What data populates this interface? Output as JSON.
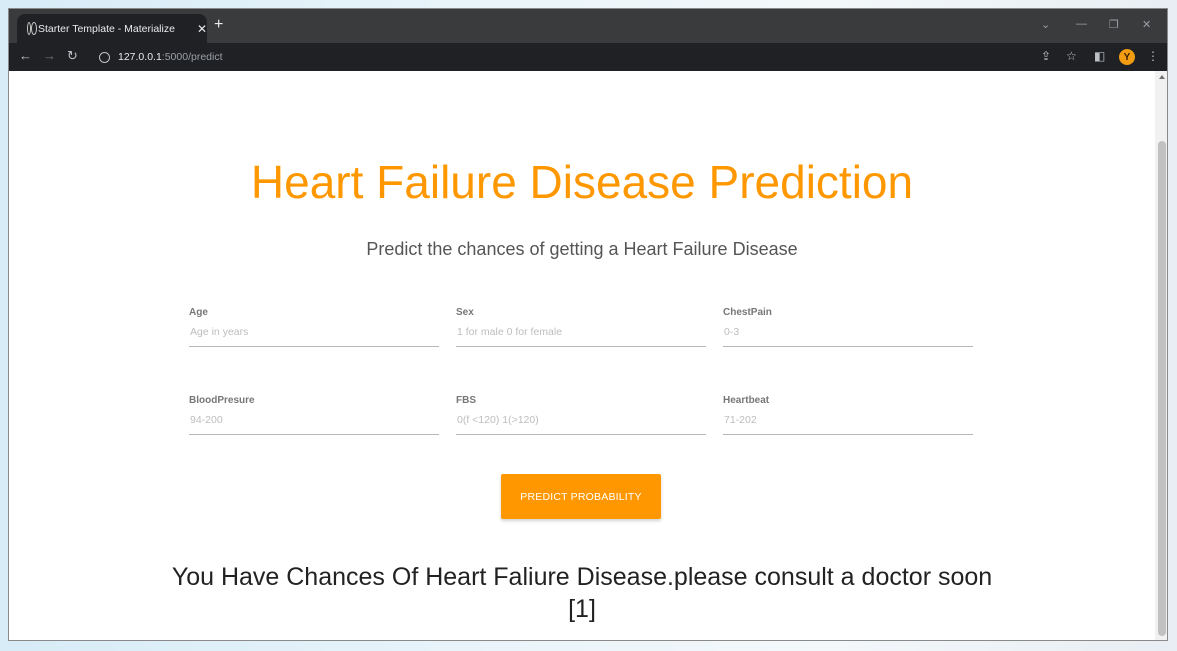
{
  "browser": {
    "tab_title": "Starter Template - Materialize",
    "tab_close": "✕",
    "new_tab": "+",
    "url_host": "127.0.0.1",
    "url_path": ":5000/predict",
    "profile_initial": "Y"
  },
  "page": {
    "title": "Heart Failure Disease Prediction",
    "subtitle": "Predict the chances of getting a Heart Failure Disease",
    "fields": [
      {
        "label": "Age",
        "placeholder": "Age in years"
      },
      {
        "label": "Sex",
        "placeholder": "1 for male 0 for female"
      },
      {
        "label": "ChestPain",
        "placeholder": "0-3"
      },
      {
        "label": "BloodPresure",
        "placeholder": "94-200"
      },
      {
        "label": "FBS",
        "placeholder": "0(f <120) 1(>120)"
      },
      {
        "label": "Heartbeat",
        "placeholder": "71-202"
      }
    ],
    "submit_label": "PREDICT PROBABILITY",
    "result_text": "You Have Chances Of Heart Faliure Disease.please consult a doctor soon [1]"
  },
  "theme": {
    "accent": "#ff9800",
    "chrome_dark": "#202124"
  }
}
